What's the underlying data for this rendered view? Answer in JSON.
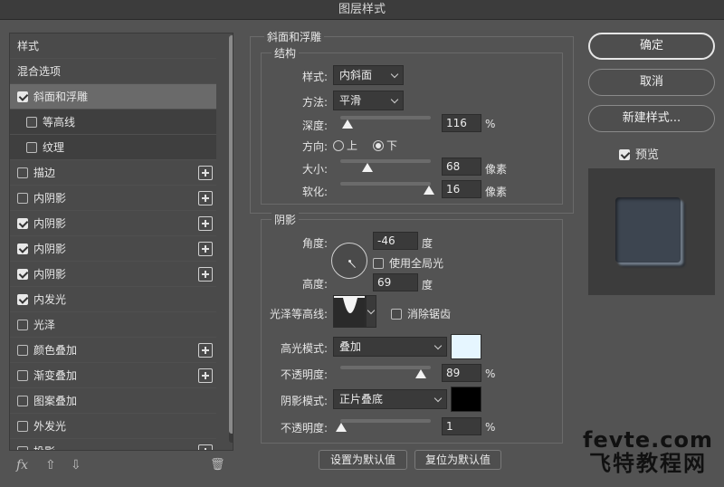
{
  "window_title": "图层样式",
  "left_panel": {
    "items": [
      {
        "label": "样式",
        "checkbox": false,
        "checked": false,
        "plus": false,
        "indent": false,
        "selected": false
      },
      {
        "label": "混合选项",
        "checkbox": false,
        "checked": false,
        "plus": false,
        "indent": false,
        "selected": false
      },
      {
        "label": "斜面和浮雕",
        "checkbox": true,
        "checked": true,
        "plus": false,
        "indent": false,
        "selected": true
      },
      {
        "label": "等高线",
        "checkbox": true,
        "checked": false,
        "plus": false,
        "indent": true,
        "selected": false
      },
      {
        "label": "纹理",
        "checkbox": true,
        "checked": false,
        "plus": false,
        "indent": true,
        "selected": false
      },
      {
        "label": "描边",
        "checkbox": true,
        "checked": false,
        "plus": true,
        "indent": false,
        "selected": false
      },
      {
        "label": "内阴影",
        "checkbox": true,
        "checked": false,
        "plus": true,
        "indent": false,
        "selected": false
      },
      {
        "label": "内阴影",
        "checkbox": true,
        "checked": true,
        "plus": true,
        "indent": false,
        "selected": false
      },
      {
        "label": "内阴影",
        "checkbox": true,
        "checked": true,
        "plus": true,
        "indent": false,
        "selected": false
      },
      {
        "label": "内阴影",
        "checkbox": true,
        "checked": true,
        "plus": true,
        "indent": false,
        "selected": false
      },
      {
        "label": "内发光",
        "checkbox": true,
        "checked": true,
        "plus": false,
        "indent": false,
        "selected": false
      },
      {
        "label": "光泽",
        "checkbox": true,
        "checked": false,
        "plus": false,
        "indent": false,
        "selected": false
      },
      {
        "label": "颜色叠加",
        "checkbox": true,
        "checked": false,
        "plus": true,
        "indent": false,
        "selected": false
      },
      {
        "label": "渐变叠加",
        "checkbox": true,
        "checked": false,
        "plus": true,
        "indent": false,
        "selected": false
      },
      {
        "label": "图案叠加",
        "checkbox": true,
        "checked": false,
        "plus": false,
        "indent": false,
        "selected": false
      },
      {
        "label": "外发光",
        "checkbox": true,
        "checked": false,
        "plus": false,
        "indent": false,
        "selected": false
      },
      {
        "label": "投影",
        "checkbox": true,
        "checked": false,
        "plus": true,
        "indent": false,
        "selected": false
      }
    ],
    "footer": {
      "fx": "fx",
      "up": "⇧",
      "down": "⇩",
      "trash": "🗑"
    }
  },
  "bevel": {
    "section_title": "斜面和浮雕",
    "structure_title": "结构",
    "style_label": "样式:",
    "style_value": "内斜面",
    "technique_label": "方法:",
    "technique_value": "平滑",
    "depth_label": "深度:",
    "depth_value": "116",
    "depth_unit": "%",
    "depth_slider": 0.08,
    "direction_label": "方向:",
    "direction_up": "上",
    "direction_down": "下",
    "direction_selected": "down",
    "size_label": "大小:",
    "size_value": "68",
    "size_unit": "像素",
    "size_slider": 0.3,
    "soften_label": "软化:",
    "soften_value": "16",
    "soften_unit": "像素",
    "soften_slider": 0.98
  },
  "shading": {
    "title": "阴影",
    "angle_label": "角度:",
    "angle_value": "-46",
    "angle_unit": "度",
    "global_light_label": "使用全局光",
    "global_light_checked": false,
    "altitude_label": "高度:",
    "altitude_value": "69",
    "altitude_unit": "度",
    "gloss_contour_label": "光泽等高线:",
    "anti_alias_label": "消除锯齿",
    "anti_alias_checked": false,
    "highlight_mode_label": "高光模式:",
    "highlight_mode_value": "叠加",
    "highlight_color": "#e6f6ff",
    "highlight_opacity_label": "不透明度:",
    "highlight_opacity_value": "89",
    "highlight_opacity_unit": "%",
    "highlight_opacity_slider": 0.89,
    "shadow_mode_label": "阴影模式:",
    "shadow_mode_value": "正片叠底",
    "shadow_color": "#000000",
    "shadow_opacity_label": "不透明度:",
    "shadow_opacity_value": "1",
    "shadow_opacity_unit": "%",
    "shadow_opacity_slider": 0.01
  },
  "bottom_buttons": {
    "make_default": "设置为默认值",
    "reset_default": "复位为默认值"
  },
  "right_panel": {
    "ok": "确定",
    "cancel": "取消",
    "new_style": "新建样式...",
    "preview_label": "预览",
    "preview_checked": true
  },
  "watermark": {
    "line1": "fevte.com",
    "line2": "飞特教程网"
  }
}
